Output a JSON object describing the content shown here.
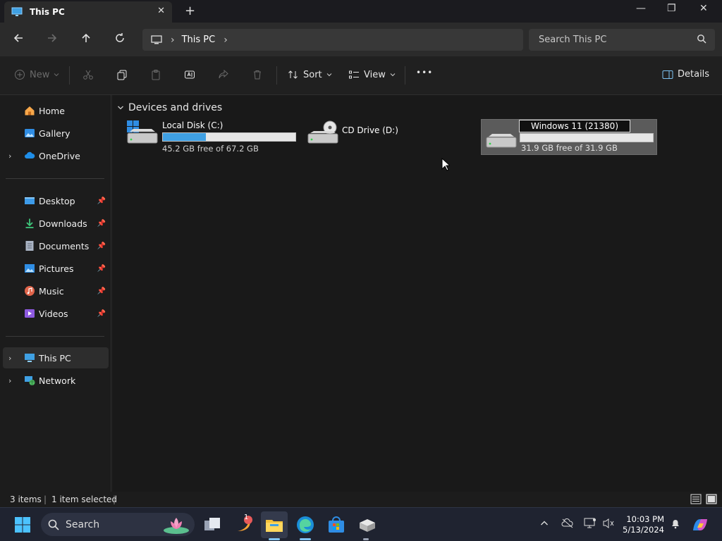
{
  "window": {
    "tab_title": "This PC",
    "tab_close": "✕",
    "new_tab": "+",
    "minimize": "—",
    "maximize": "❐",
    "close": "✕"
  },
  "address": {
    "root_chevron": "›",
    "crumb": "This PC",
    "trail_chevron": "›",
    "search_placeholder": "Search This PC"
  },
  "commands": {
    "new_label": "New",
    "sort_label": "Sort",
    "view_label": "View",
    "more_label": "•••",
    "details_label": "Details"
  },
  "sidebar": {
    "items": [
      {
        "label": "Home"
      },
      {
        "label": "Gallery"
      },
      {
        "label": "OneDrive"
      },
      {
        "label": "Desktop"
      },
      {
        "label": "Downloads"
      },
      {
        "label": "Documents"
      },
      {
        "label": "Pictures"
      },
      {
        "label": "Music"
      },
      {
        "label": "Videos"
      },
      {
        "label": "This PC"
      },
      {
        "label": "Network"
      }
    ]
  },
  "main": {
    "group_title": "Devices and drives",
    "drives": [
      {
        "name": "Local Disk (C:)",
        "free": "45.2 GB free of 67.2 GB",
        "used_fraction": 0.327
      },
      {
        "name": "CD Drive (D:)"
      },
      {
        "name": "Windows 11 (21380)",
        "free": "31.9 GB free of 31.9 GB",
        "used_fraction": 0.0
      }
    ]
  },
  "status": {
    "items_count": "3 items",
    "selected_count": "1 item selected"
  },
  "taskbar": {
    "search_label": "Search",
    "time": "10:03 PM",
    "date": "5/13/2024",
    "badge": "1"
  },
  "colors": {
    "accent": "#3fa0e3",
    "background": "#191919"
  }
}
